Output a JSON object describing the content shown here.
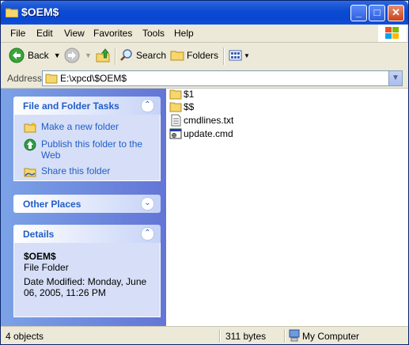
{
  "window": {
    "title": "$OEM$"
  },
  "menu": [
    "File",
    "Edit",
    "View",
    "Favorites",
    "Tools",
    "Help"
  ],
  "toolbar": {
    "back": "Back",
    "search": "Search",
    "folders": "Folders"
  },
  "address": {
    "label": "Address",
    "value": "E:\\xpcd\\$OEM$"
  },
  "tasks": {
    "title": "File and Folder Tasks",
    "items": [
      "Make a new folder",
      "Publish this folder to the Web",
      "Share this folder"
    ]
  },
  "other_places": {
    "title": "Other Places"
  },
  "details": {
    "title": "Details",
    "name": "$OEM$",
    "type": "File Folder",
    "modified": "Date Modified: Monday, June 06, 2005, 11:26 PM"
  },
  "files": [
    {
      "name": "$1",
      "icon": "folder-icon"
    },
    {
      "name": "$$",
      "icon": "folder-icon"
    },
    {
      "name": "cmdlines.txt",
      "icon": "text-file-icon"
    },
    {
      "name": "update.cmd",
      "icon": "cmd-file-icon"
    }
  ],
  "status": {
    "objects": "4 objects",
    "size": "311 bytes",
    "location": "My Computer"
  },
  "colors": {
    "titlebar": "#0A47D0",
    "task_link": "#215DC6",
    "pane": "#6F8FDD"
  }
}
